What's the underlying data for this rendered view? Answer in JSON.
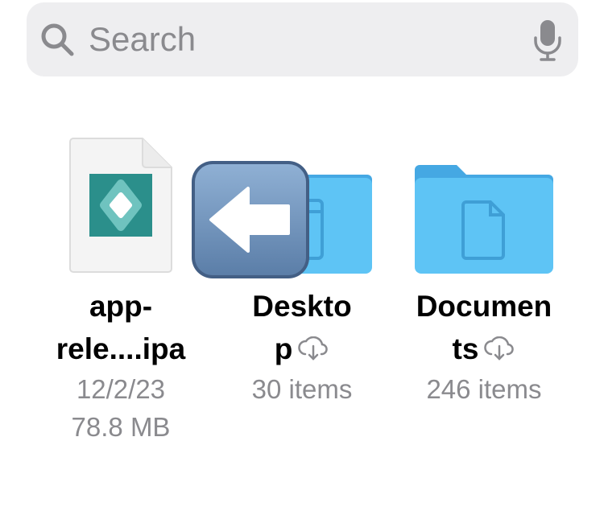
{
  "search": {
    "placeholder": "Search"
  },
  "files": [
    {
      "name_line1": "app-",
      "name_line2": "rele....ipa",
      "date": "12/2/23",
      "size": "78.8 MB"
    },
    {
      "name_line1": "Deskto",
      "name_line2": "p",
      "count": "30 items"
    },
    {
      "name_line1": "Documen",
      "name_line2": "ts",
      "count": "246 items"
    }
  ],
  "icons": {
    "search": "magnifier-icon",
    "mic": "mic-icon",
    "cloud": "icloud-download-icon",
    "back": "back-arrow-emoji-icon"
  },
  "colors": {
    "folder": "#5ec4f5",
    "folder_tab": "#45a8e3",
    "search_bg": "#eeeef0",
    "secondary_text": "#8a8a8e",
    "app_icon": "#2b8f8b"
  }
}
